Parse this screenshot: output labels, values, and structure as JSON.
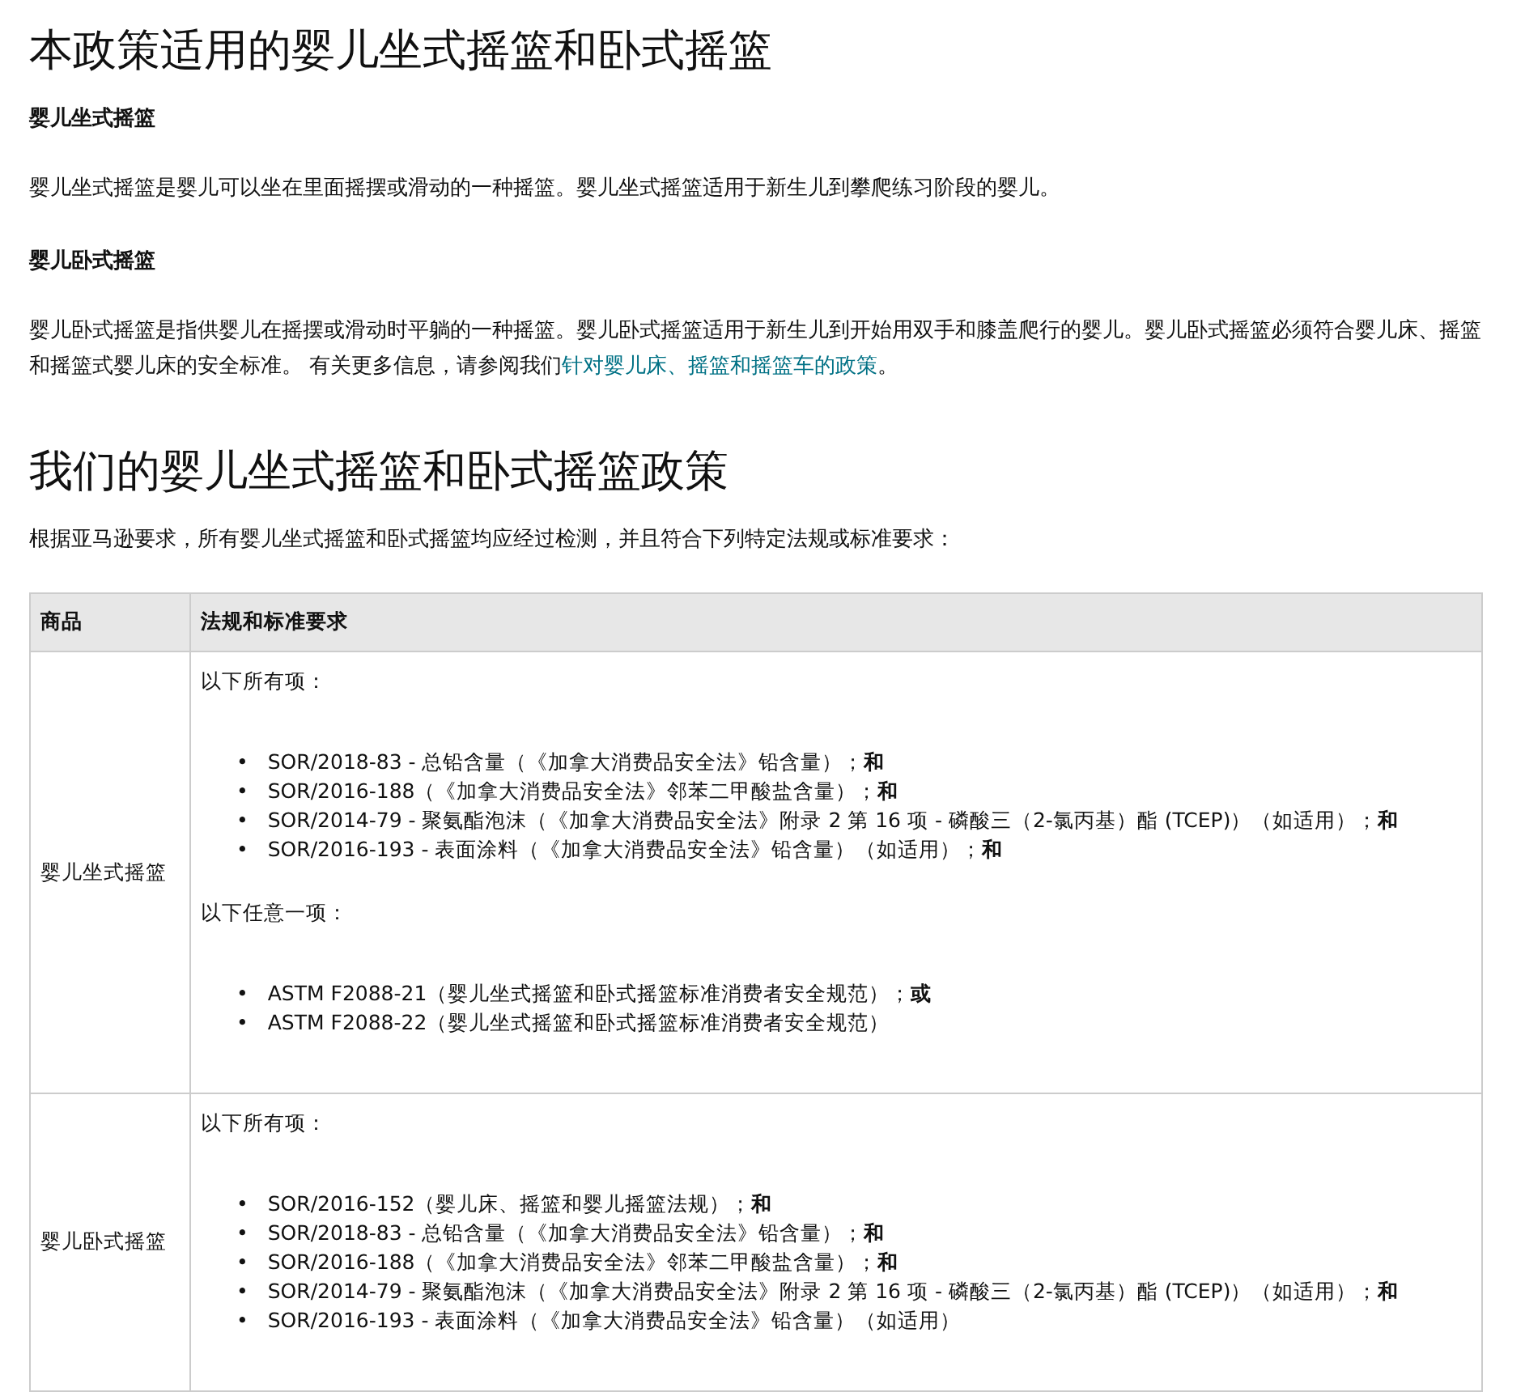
{
  "sections": [
    {
      "title": "本政策适用的婴儿坐式摇篮和卧式摇篮",
      "blocks": [
        {
          "heading": "婴儿坐式摇篮",
          "text": "婴儿坐式摇篮是婴儿可以坐在里面摇摆或滑动的一种摇篮。婴儿坐式摇篮适用于新生儿到攀爬练习阶段的婴儿。"
        },
        {
          "heading": "婴儿卧式摇篮",
          "text": "婴儿卧式摇篮是指供婴儿在摇摆或滑动时平躺的一种摇篮。婴儿卧式摇篮适用于新生儿到开始用双手和膝盖爬行的婴儿。婴儿卧式摇篮必须符合婴儿床、摇篮和摇篮式婴儿床的安全标准。 有关更多信息，请参阅我们",
          "link": "针对婴儿床、摇篮和摇篮车的政策",
          "after": "。"
        }
      ]
    },
    {
      "title": "我们的婴儿坐式摇篮和卧式摇篮政策",
      "intro": "根据亚马逊要求，所有婴儿坐式摇篮和卧式摇篮均应经过检测，并且符合下列特定法规或标准要求：",
      "table": {
        "columns": [
          "商品",
          "法规和标准要求"
        ],
        "rows": [
          {
            "product": "婴儿坐式摇篮",
            "groups": [
              {
                "label": "以下所有项：",
                "bullet": "•",
                "items": [
                  "SOR/2018-83 - 总铅含量（《加拿大消费品安全法》铅含量）；**和**",
                  "SOR/2016-188（《加拿大消费品安全法》邻苯二甲酸盐含量）；**和**",
                  "SOR/2014-79 - 聚氨酯泡沫（《加拿大消费品安全法》附录 2 第 16 项 - 磷酸三（2-氯丙基）酯 (TCEP)）（如适用）；**和**",
                  "SOR/2016-193 - 表面涂料（《加拿大消费品安全法》铅含量）（如适用）；**和**"
                ]
              },
              {
                "label": "以下任意一项：",
                "bullet": "•",
                "items": [
                  "ASTM F2088-21（婴儿坐式摇篮和卧式摇篮标准消费者安全规范）；**或**",
                  "ASTM F2088-22（婴儿坐式摇篮和卧式摇篮标准消费者安全规范）"
                ]
              }
            ]
          },
          {
            "product": "婴儿卧式摇篮",
            "groups": [
              {
                "label": "以下所有项：",
                "bullet": "•",
                "items": [
                  "SOR/2016-152（婴儿床、摇篮和婴儿摇篮法规）；**和**",
                  "SOR/2018-83 - 总铅含量（《加拿大消费品安全法》铅含量）；**和**",
                  "SOR/2016-188（《加拿大消费品安全法》邻苯二甲酸盐含量）；**和**",
                  "SOR/2014-79 - 聚氨酯泡沫（《加拿大消费品安全法》附录 2 第 16 项 - 磷酸三（2-氯丙基）酯 (TCEP)）（如适用）；**和**",
                  "SOR/2016-193 - 表面涂料（《加拿大消费品安全法》铅含量）（如适用）"
                ]
              }
            ]
          }
        ]
      }
    }
  ]
}
